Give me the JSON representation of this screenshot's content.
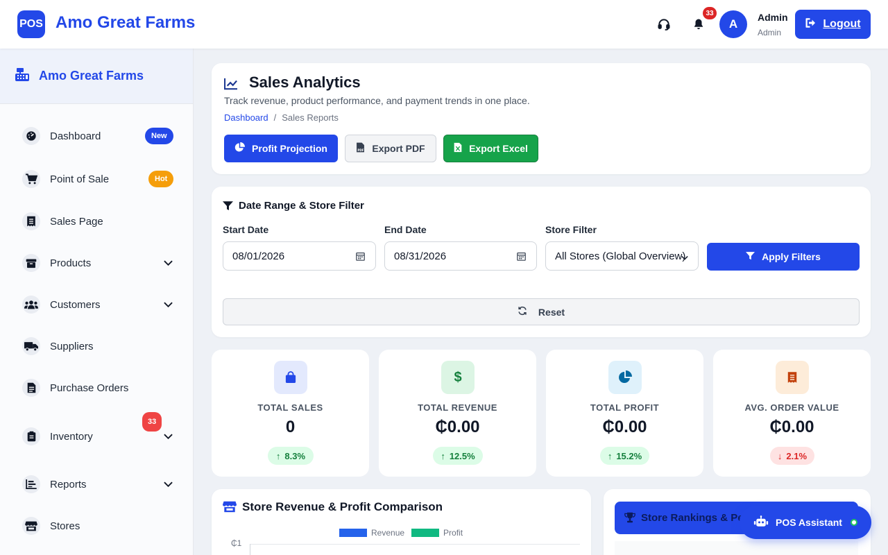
{
  "topbar": {
    "logo_text": "POS",
    "brand": "Amo Great Farms",
    "support_icon": "headset-icon",
    "notification_icon": "bell-icon",
    "notification_count": "33",
    "avatar_initial": "A",
    "user_name": "Admin",
    "user_role": "Admin",
    "logout_label": "Logout"
  },
  "sidebar": {
    "title": "Amo Great Farms",
    "items": [
      {
        "label": "Dashboard",
        "icon": "gauge-icon",
        "badge": "New"
      },
      {
        "label": "Point of Sale",
        "icon": "cart-icon",
        "badge": "Hot"
      },
      {
        "label": "Sales Page",
        "icon": "receipt-icon"
      },
      {
        "label": "Products",
        "icon": "box-icon"
      },
      {
        "label": "Customers",
        "icon": "users-icon"
      },
      {
        "label": "Suppliers",
        "icon": "truck-icon"
      },
      {
        "label": "Purchase Orders",
        "icon": "file-icon"
      },
      {
        "label": "Inventory",
        "icon": "clipboard-icon",
        "badge": "33"
      },
      {
        "label": "Reports",
        "icon": "chart-icon"
      },
      {
        "label": "Stores",
        "icon": "store-icon"
      }
    ]
  },
  "header": {
    "title": "Sales Analytics",
    "subtitle": "Track revenue, product performance, and payment trends in one place.",
    "breadcrumb_home": "Dashboard",
    "breadcrumb_sep": "/",
    "breadcrumb_current": "Sales Reports",
    "btn_profit": "Profit Projection",
    "btn_pdf": "Export PDF",
    "btn_excel": "Export Excel"
  },
  "filters": {
    "title": "Date Range & Store Filter",
    "start_label": "Start Date",
    "start_value": "08/01/2026",
    "end_label": "End Date",
    "end_value": "08/31/2026",
    "store_label": "Store Filter",
    "store_value": "All Stores (Global Overview)",
    "apply_label": "Apply Filters",
    "reset_label": "Reset"
  },
  "stats": [
    {
      "label": "TOTAL SALES",
      "value": "0",
      "change": "8.3%",
      "direction": "up",
      "color": "#2348e8"
    },
    {
      "label": "TOTAL REVENUE",
      "value": "₵0.00",
      "change": "12.5%",
      "direction": "up",
      "color": "#16a34a"
    },
    {
      "label": "TOTAL PROFIT",
      "value": "₵0.00",
      "change": "15.2%",
      "direction": "up",
      "color": "#0369a1"
    },
    {
      "label": "AVG. ORDER VALUE",
      "value": "₵0.00",
      "change": "2.1%",
      "direction": "down",
      "color": "#c2410c"
    }
  ],
  "comparison": {
    "title": "Store Revenue & Profit Comparison",
    "legend_revenue": "Revenue",
    "legend_profit": "Profit",
    "y_tick_top": "₵1"
  },
  "rankings": {
    "title": "Store Rankings & Pe"
  },
  "assistant": {
    "label": "POS Assistant"
  },
  "colors": {
    "primary": "#2348e8",
    "success": "#16a34a",
    "danger": "#dc2626",
    "warning": "#f59e0b"
  }
}
